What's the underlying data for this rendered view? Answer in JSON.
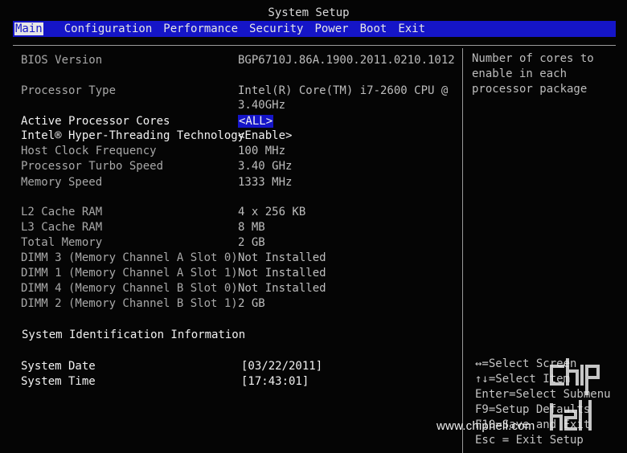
{
  "window": {
    "title": "System Setup"
  },
  "menu": [
    {
      "label": "Main"
    },
    {
      "label": "Configuration"
    },
    {
      "label": "Performance"
    },
    {
      "label": "Security"
    },
    {
      "label": "Power"
    },
    {
      "label": "Boot"
    },
    {
      "label": "Exit"
    }
  ],
  "info": {
    "bios_version_label": "BIOS Version",
    "bios_version_value": "BGP6710J.86A.1900.2011.0210.1012",
    "processor_type_label": "Processor Type",
    "processor_type_value_line1": "Intel(R) Core(TM) i7-2600 CPU @",
    "processor_type_value_line2": "3.40GHz",
    "active_processor_cores_label": "Active Processor Cores",
    "active_processor_cores_value": "<ALL>",
    "hyper_threading_label": "Intel® Hyper-Threading Technology",
    "hyper_threading_value": "<Enable>",
    "host_clock_label": "Host Clock Frequency",
    "host_clock_value": "100 MHz",
    "turbo_speed_label": "Processor Turbo Speed",
    "turbo_speed_value": "3.40 GHz",
    "memory_speed_label": "Memory Speed",
    "memory_speed_value": "1333 MHz",
    "l2_cache_label": "L2 Cache RAM",
    "l2_cache_value": "4 x 256 KB",
    "l3_cache_label": "L3 Cache RAM",
    "l3_cache_value": "8 MB",
    "total_memory_label": "Total Memory",
    "total_memory_value": "2 GB"
  },
  "dimms": [
    {
      "label": "DIMM 3 (Memory Channel A Slot 0)",
      "value": "Not Installed"
    },
    {
      "label": "DIMM 1 (Memory Channel A Slot 1)",
      "value": "Not Installed"
    },
    {
      "label": "DIMM 4 (Memory Channel B Slot 0)",
      "value": "Not Installed"
    },
    {
      "label": "DIMM 2 (Memory Channel B Slot 1)",
      "value": "2 GB"
    }
  ],
  "system_id": {
    "section_title": "System Identification Information",
    "date_label": "System Date",
    "date_value": "[03/22/2011]",
    "time_label": "System Time",
    "time_value": "[17:43:01]"
  },
  "help": {
    "text": "Number of cores to\nenable in each\nprocessor package"
  },
  "keys": [
    {
      "text": "↔=Select Screen"
    },
    {
      "text": "↑↓=Select Item"
    },
    {
      "text": "Enter=Select Submenu"
    },
    {
      "text": "F9=Setup Defaults"
    },
    {
      "text": "F10=Save and Exit"
    },
    {
      "text": "Esc = Exit Setup"
    }
  ],
  "watermark": {
    "url": "www.chiphell.com",
    "logo_text": "chip hell"
  },
  "colors": {
    "menu_bar": "#1515c8",
    "background": "#050505",
    "text": "#bdbdbd",
    "highlight_text": "#f2f2f2"
  }
}
